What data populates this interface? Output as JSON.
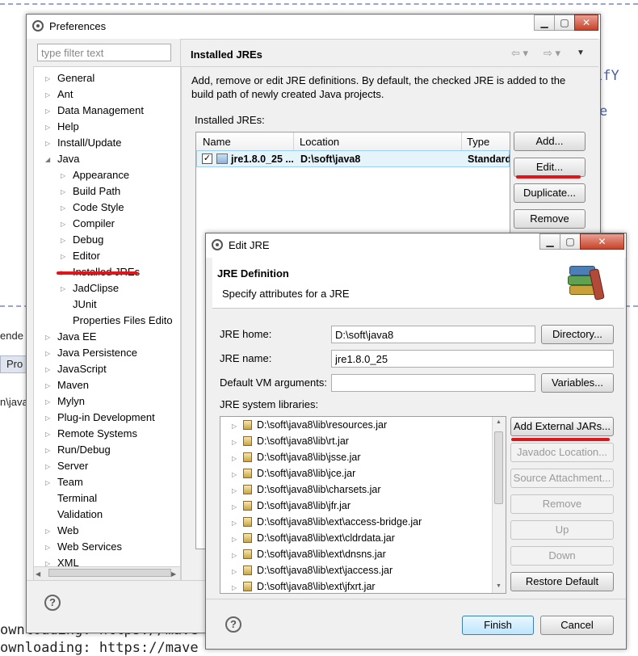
{
  "background": {
    "code_lines": [
      "ownloading: https://mave",
      "ownloading: https://mave"
    ],
    "side_lines": [
      "ifY",
      "e"
    ],
    "left_labels": [
      "ende",
      "Pro",
      "n\\java"
    ]
  },
  "preferences": {
    "title": "Preferences",
    "filter_placeholder": "type filter text",
    "tree": [
      {
        "label": "General",
        "level": 0,
        "expand": "closed"
      },
      {
        "label": "Ant",
        "level": 0,
        "expand": "closed"
      },
      {
        "label": "Data Management",
        "level": 0,
        "expand": "closed"
      },
      {
        "label": "Help",
        "level": 0,
        "expand": "closed"
      },
      {
        "label": "Install/Update",
        "level": 0,
        "expand": "closed"
      },
      {
        "label": "Java",
        "level": 0,
        "expand": "open"
      },
      {
        "label": "Appearance",
        "level": 1,
        "expand": "closed"
      },
      {
        "label": "Build Path",
        "level": 1,
        "expand": "closed"
      },
      {
        "label": "Code Style",
        "level": 1,
        "expand": "closed"
      },
      {
        "label": "Compiler",
        "level": 1,
        "expand": "closed"
      },
      {
        "label": "Debug",
        "level": 1,
        "expand": "closed"
      },
      {
        "label": "Editor",
        "level": 1,
        "expand": "closed"
      },
      {
        "label": "Installed JREs",
        "level": 1,
        "expand": "closed"
      },
      {
        "label": "JadClipse",
        "level": 1,
        "expand": "closed"
      },
      {
        "label": "JUnit",
        "level": 1,
        "expand": "none"
      },
      {
        "label": "Properties Files Edito",
        "level": 1,
        "expand": "none"
      },
      {
        "label": "Java EE",
        "level": 0,
        "expand": "closed"
      },
      {
        "label": "Java Persistence",
        "level": 0,
        "expand": "closed"
      },
      {
        "label": "JavaScript",
        "level": 0,
        "expand": "closed"
      },
      {
        "label": "Maven",
        "level": 0,
        "expand": "closed"
      },
      {
        "label": "Mylyn",
        "level": 0,
        "expand": "closed"
      },
      {
        "label": "Plug-in Development",
        "level": 0,
        "expand": "closed"
      },
      {
        "label": "Remote Systems",
        "level": 0,
        "expand": "closed"
      },
      {
        "label": "Run/Debug",
        "level": 0,
        "expand": "closed"
      },
      {
        "label": "Server",
        "level": 0,
        "expand": "closed"
      },
      {
        "label": "Team",
        "level": 0,
        "expand": "closed"
      },
      {
        "label": "Terminal",
        "level": 0,
        "expand": "none"
      },
      {
        "label": "Validation",
        "level": 0,
        "expand": "none"
      },
      {
        "label": "Web",
        "level": 0,
        "expand": "closed"
      },
      {
        "label": "Web Services",
        "level": 0,
        "expand": "closed"
      },
      {
        "label": "XML",
        "level": 0,
        "expand": "closed"
      }
    ],
    "page_title": "Installed JREs",
    "description": "Add, remove or edit JRE definitions. By default, the checked JRE is added to the build path of newly created Java projects.",
    "table_label": "Installed JREs:",
    "columns": [
      "Name",
      "Location",
      "Type"
    ],
    "row": {
      "name": "jre1.8.0_25 ...",
      "location": "D:\\soft\\java8",
      "type": "Standard"
    },
    "buttons": {
      "add": "Add...",
      "edit": "Edit...",
      "duplicate": "Duplicate...",
      "remove": "Remove"
    }
  },
  "edit_jre": {
    "title": "Edit JRE",
    "heading": "JRE Definition",
    "subheading": "Specify attributes for a JRE",
    "jre_home_label": "JRE home:",
    "jre_home_value": "D:\\soft\\java8",
    "jre_name_label": "JRE name:",
    "jre_name_value": "jre1.8.0_25",
    "vm_args_label": "Default VM arguments:",
    "vm_args_value": "",
    "libraries_label": "JRE system libraries:",
    "libraries": [
      "D:\\soft\\java8\\lib\\resources.jar",
      "D:\\soft\\java8\\lib\\rt.jar",
      "D:\\soft\\java8\\lib\\jsse.jar",
      "D:\\soft\\java8\\lib\\jce.jar",
      "D:\\soft\\java8\\lib\\charsets.jar",
      "D:\\soft\\java8\\lib\\jfr.jar",
      "D:\\soft\\java8\\lib\\ext\\access-bridge.jar",
      "D:\\soft\\java8\\lib\\ext\\cldrdata.jar",
      "D:\\soft\\java8\\lib\\ext\\dnsns.jar",
      "D:\\soft\\java8\\lib\\ext\\jaccess.jar",
      "D:\\soft\\java8\\lib\\ext\\jfxrt.jar"
    ],
    "buttons": {
      "directory": "Directory...",
      "variables": "Variables...",
      "add_external_jars": "Add External JARs...",
      "javadoc_location": "Javadoc Location...",
      "source_attachment": "Source Attachment...",
      "remove": "Remove",
      "up": "Up",
      "down": "Down",
      "restore_default": "Restore Default",
      "finish": "Finish",
      "cancel": "Cancel"
    }
  },
  "colors": {
    "highlight_underline": "#e0141b",
    "selection": "#cce8ff"
  }
}
